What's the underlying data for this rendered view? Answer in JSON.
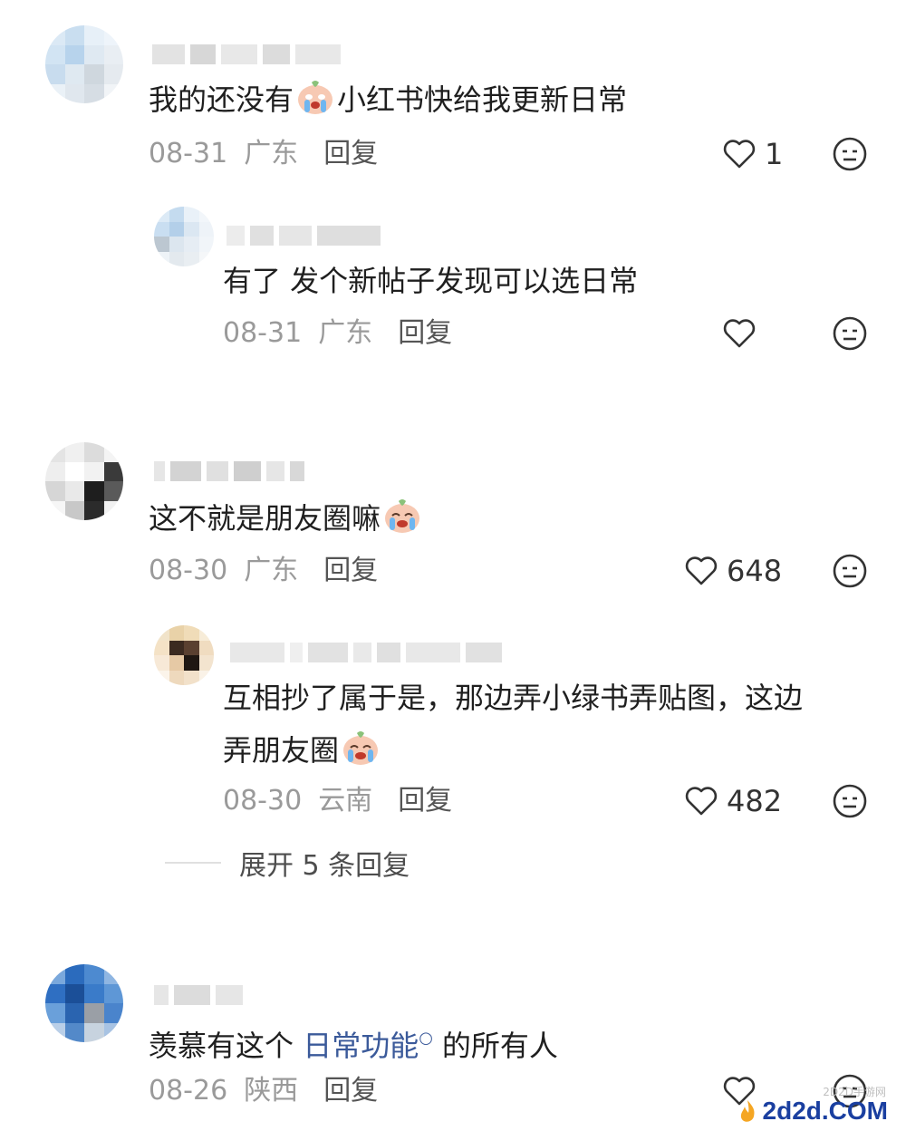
{
  "comments": [
    {
      "text_a": "我的还没有",
      "text_b": "小红书快给我更新日常",
      "date": "08-31",
      "region": "广东",
      "reply_label": "回复",
      "likes": "1"
    },
    {
      "text": "有了 发个新帖子发现可以选日常",
      "date": "08-31",
      "region": "广东",
      "reply_label": "回复",
      "likes": ""
    },
    {
      "text_a": "这不就是朋友圈嘛",
      "date": "08-30",
      "region": "广东",
      "reply_label": "回复",
      "likes": "648"
    },
    {
      "text_line1": "互相抄了属于是，那边弄小绿书弄贴图，这边",
      "text_line2": "弄朋友圈",
      "date": "08-30",
      "region": "云南",
      "reply_label": "回复",
      "likes": "482"
    },
    {
      "text_a": "羡慕有这个",
      "link_text": "日常功能",
      "text_b": "的所有人",
      "date": "08-26",
      "region": "陕西",
      "reply_label": "回复",
      "likes": ""
    }
  ],
  "expand_replies_label": "展开 5 条回复",
  "watermark": {
    "logo": "2d2d.COM",
    "caption": "2D2D手游网"
  },
  "icons": {
    "like": "heart-outline-icon",
    "dislike": "neutral-face-icon",
    "emoji_cry": "crying-emoji-icon",
    "search_mark": "search-icon"
  },
  "colors": {
    "link": "#3b5a9a",
    "meta": "#9a9a9a"
  }
}
